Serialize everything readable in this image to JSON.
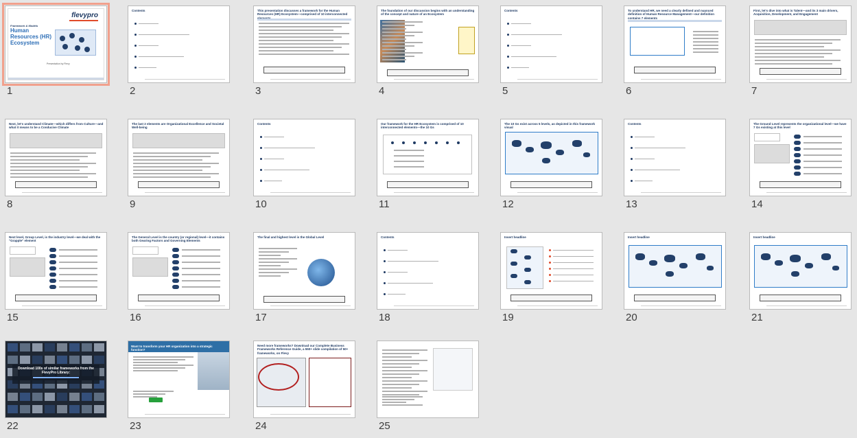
{
  "slides": [
    {
      "num": "1",
      "kind": "cover",
      "title": "Human Resources (HR) Ecosystem",
      "subtitle": "Framework & Models",
      "logo": "flevypro",
      "presenter": "Presentation by Flevy"
    },
    {
      "num": "2",
      "kind": "contents",
      "title": "Contents"
    },
    {
      "num": "3",
      "kind": "text",
      "title": "This presentation discusses a framework for the Human Resources (HR) Ecosystem—comprised of 10 interconnected elements"
    },
    {
      "num": "4",
      "kind": "image-text",
      "title": "The foundation of our discussion begins with an understanding of the concept and nature of an Ecosystem"
    },
    {
      "num": "5",
      "kind": "contents",
      "title": "Contents"
    },
    {
      "num": "6",
      "kind": "list",
      "title": "To understand HR, we need a clearly defined and nuanced definition of Human Resource Management—our definition contains 7 elements"
    },
    {
      "num": "7",
      "kind": "quote",
      "title": "First, let's dive into what is Talent—and its 3 main drivers, Acquisition, Development, and Engagement"
    },
    {
      "num": "8",
      "kind": "quote",
      "title": "Next, let's understand Climate—which differs from Culture—and what it means to be a Conducive Climate"
    },
    {
      "num": "9",
      "kind": "quote",
      "title": "The last 2 elements are Organizational Excellence and Societal Well-being"
    },
    {
      "num": "10",
      "kind": "contents",
      "title": "Contents"
    },
    {
      "num": "11",
      "kind": "chart",
      "title": "Our framework for the HR Ecosystem is comprised of 10 interconnected elements—the 10 Gs"
    },
    {
      "num": "12",
      "kind": "diagram",
      "title": "The 10 Gs exist across 5 levels, as depicted in this framework visual"
    },
    {
      "num": "13",
      "kind": "contents",
      "title": "Contents"
    },
    {
      "num": "14",
      "kind": "levels",
      "title": "The Ground Level represents the organizational level—we have 7 Gs existing at this level"
    },
    {
      "num": "15",
      "kind": "levels",
      "title": "Next level, Group Level, is the industry level—we deal with the \"Grapple\" element"
    },
    {
      "num": "16",
      "kind": "levels",
      "title": "The General Level is the country (or regional) level—it contains both Gearing Factors and Governing Elements"
    },
    {
      "num": "17",
      "kind": "globe",
      "title": "The final and highest level is the Global Level"
    },
    {
      "num": "18",
      "kind": "contents",
      "title": "Contents"
    },
    {
      "num": "19",
      "kind": "headline",
      "title": "Insert headline"
    },
    {
      "num": "20",
      "kind": "headline-diagram",
      "title": "Insert headline"
    },
    {
      "num": "21",
      "kind": "headline-diagram",
      "title": "Insert headline"
    },
    {
      "num": "22",
      "kind": "library",
      "title": "Download 100s of similar frameworks from the FlevyPro Library:"
    },
    {
      "num": "23",
      "kind": "promo",
      "title": "Want to transform your HR organization into a strategic function?"
    },
    {
      "num": "24",
      "kind": "promo-shot",
      "title": "Need more frameworks? Download our Complete Business Frameworks Reference Guide, a 550+ slide compilation of 50+ frameworks, on Flevy"
    },
    {
      "num": "25",
      "kind": "promo-doc",
      "title": ""
    }
  ],
  "selected": "1",
  "colors": {
    "selection": "#f1a08c",
    "navy": "#1f3a63",
    "bg": "#e6e6e6"
  }
}
